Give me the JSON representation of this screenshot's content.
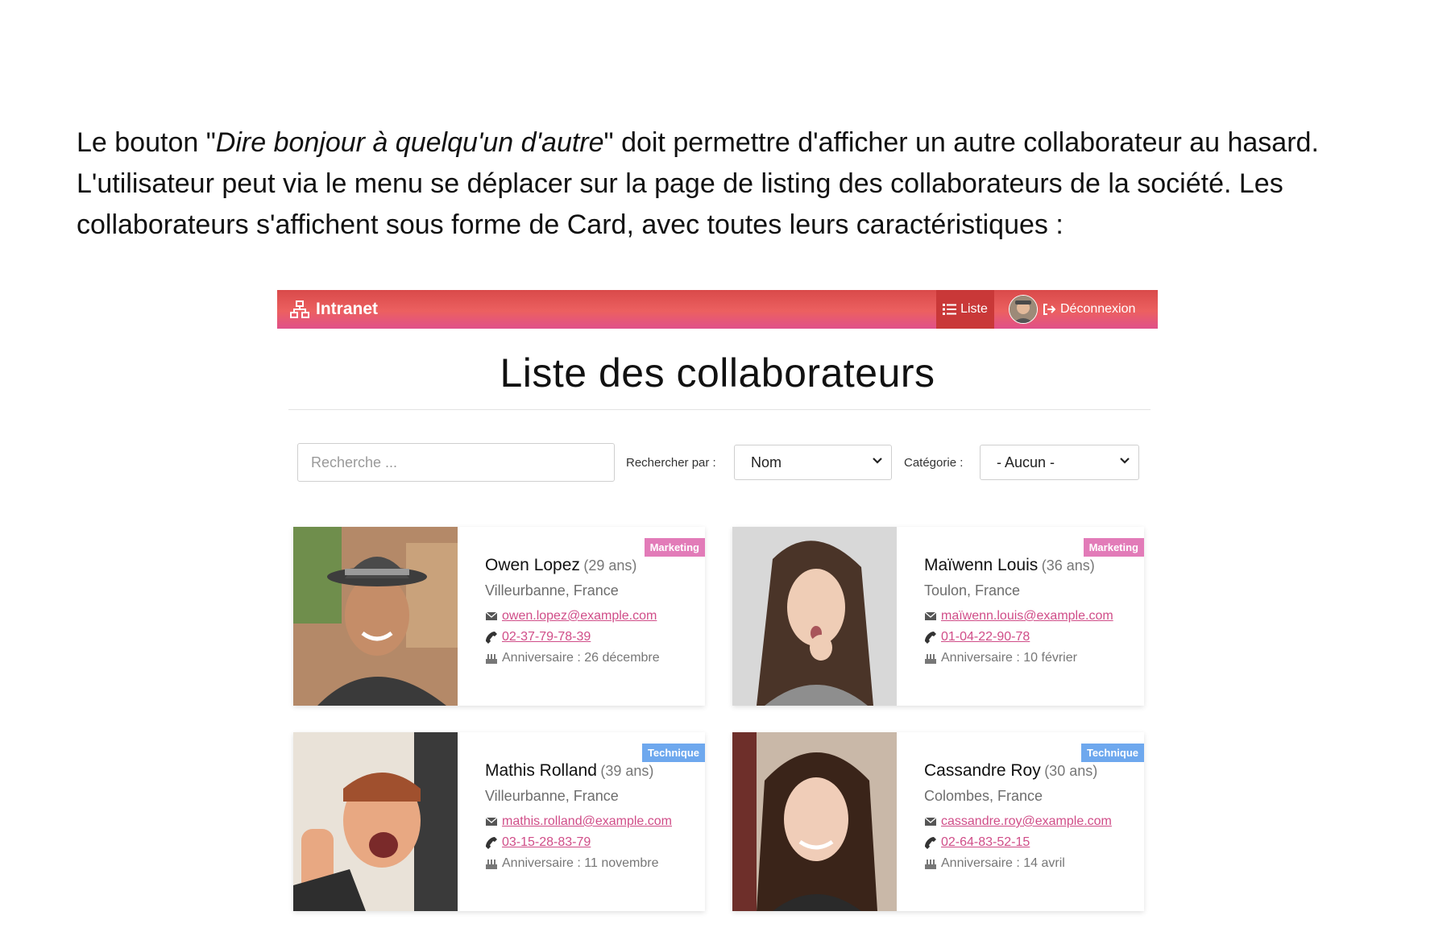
{
  "paragraph": {
    "part1": "Le bouton \"",
    "italic": "Dire bonjour à quelqu'un d'autre",
    "part2": "\" doit permettre d'afficher un autre collaborateur au hasard. L'utilisateur peut via le menu se déplacer sur la page de listing des collaborateurs de la société. Les collaborateurs s'affichent sous forme de Card, avec toutes leurs caractéristiques :"
  },
  "navbar": {
    "brand": "Intranet",
    "list_label": "Liste",
    "logout_label": "Déconnexion"
  },
  "page": {
    "title": "Liste des collaborateurs"
  },
  "filters": {
    "search_placeholder": "Recherche ...",
    "search_by_label": "Rechercher par :",
    "search_by_value": "Nom",
    "category_label": "Catégorie :",
    "category_value": "- Aucun -"
  },
  "colors": {
    "navbar_red": "#e15252",
    "navbar_active": "#c93838",
    "marketing_badge": "#e27bb8",
    "technique_badge": "#6ea8ee",
    "link": "#d04d88"
  },
  "collaborators": [
    {
      "name": "Owen Lopez",
      "age": "(29 ans)",
      "location": "Villeurbanne, France",
      "email": "owen.lopez@example.com",
      "phone": "02-37-79-78-39",
      "birthday": "Anniversaire : 26 décembre",
      "category": "Marketing"
    },
    {
      "name": "Maïwenn Louis",
      "age": "(36 ans)",
      "location": "Toulon, France",
      "email": "maïwenn.louis@example.com",
      "phone": "01-04-22-90-78",
      "birthday": "Anniversaire : 10 février",
      "category": "Marketing"
    },
    {
      "name": "Mathis Rolland",
      "age": "(39 ans)",
      "location": "Villeurbanne, France",
      "email": "mathis.rolland@example.com",
      "phone": "03-15-28-83-79",
      "birthday": "Anniversaire : 11 novembre",
      "category": "Technique"
    },
    {
      "name": "Cassandre Roy",
      "age": "(30 ans)",
      "location": "Colombes, France",
      "email": "cassandre.roy@example.com",
      "phone": "02-64-83-52-15",
      "birthday": "Anniversaire : 14 avril",
      "category": "Technique"
    }
  ]
}
